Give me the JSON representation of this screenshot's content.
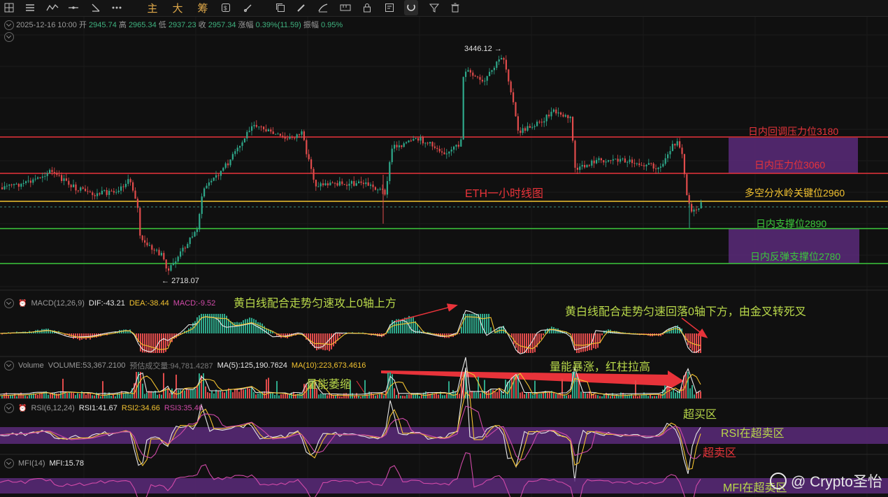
{
  "toolbar": {
    "zhu_label": "主",
    "da_label": "大",
    "chou_label": "筹"
  },
  "ohlc": {
    "date": "2025-12-16 10:00",
    "open_label": "开",
    "open": "2945.74",
    "high_label": "高",
    "high": "2965.34",
    "low_label": "低",
    "low": "2937.23",
    "close_label": "收",
    "close": "2957.34",
    "change_label": "涨幅",
    "change": "0.39%(11.59)",
    "amplitude_label": "振幅",
    "amplitude": "0.95%"
  },
  "price_chart": {
    "title_annotation": "ETH一小时线图",
    "high_marker": "3446.12",
    "low_marker": "2718.07",
    "levels": [
      {
        "label": "日内回调压力位3180",
        "color": "#e8333a"
      },
      {
        "label": "日内压力位3060",
        "color": "#e8333a"
      },
      {
        "label": "多空分水岭关键位2960",
        "color": "#f2c230"
      },
      {
        "label": "日内支撑位2890",
        "color": "#3cc83c"
      },
      {
        "label": "日内反弹支撑位2780",
        "color": "#3cc83c"
      }
    ]
  },
  "macd": {
    "name": "MACD(12,26,9)",
    "dif": "DIF:-43.21",
    "dea": "DEA:-38.44",
    "macd": "MACD:-9.52",
    "annotation_left": "黄白线配合走势匀速攻上0轴上方",
    "annotation_right": "黄白线配合走势匀速回落0轴下方，由金叉转死叉"
  },
  "volume": {
    "name": "Volume",
    "volume": "VOLUME:53,367.2100",
    "estimate": "预估成交量:94,781.4287",
    "ma5": "MA(5):125,190.7624",
    "ma10": "MA(10):223,673.4616",
    "annotation_left": "量能萎缩",
    "annotation_right": "量能暴涨，红柱拉高"
  },
  "rsi": {
    "name": "RSI(6,12,24)",
    "rsi1": "RSI1:41.67",
    "rsi2": "RSI2:34.66",
    "rsi3": "RSI3:35.46",
    "overbought_label": "超买区",
    "status_label": "RSI在超卖区",
    "oversold_label": "超卖区"
  },
  "mfi": {
    "name": "MFI(14)",
    "mfi": "MFI:15.78",
    "status_label": "MFI在超卖区"
  },
  "watermark": "@ Crypto圣怡",
  "colors": {
    "up": "#2ea88a",
    "down": "#e04b4b",
    "resistance": "#e8333a",
    "pivot": "#f2c230",
    "support": "#3cc83c",
    "annotation_green": "#b8d84a",
    "annotation_red": "#e8333a",
    "zone_purple": "#5a2a7a"
  }
}
